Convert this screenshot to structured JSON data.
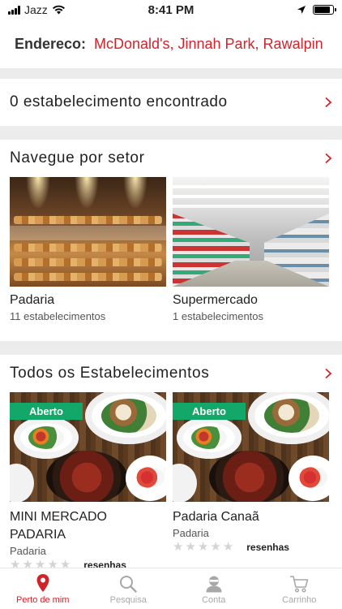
{
  "status_bar": {
    "carrier": "Jazz",
    "time": "8:41 PM"
  },
  "address": {
    "label": "Endereco:",
    "value": "McDonald's, Jinnah Park, Rawalpin"
  },
  "found": {
    "title": "0 estabelecimento encontrado"
  },
  "sectors_section": {
    "title": "Navegue por setor",
    "items": [
      {
        "name": "Padaria",
        "count": "11 estabelecimentos"
      },
      {
        "name": "Supermercado",
        "count": "1 estabelecimentos"
      }
    ]
  },
  "all_section": {
    "title": "Todos os Estabelecimentos",
    "stores": [
      {
        "badge": "Aberto",
        "name": "MINI MERCADO PADARIA",
        "category": "Padaria",
        "reviews": "resenhas",
        "rating": 0
      },
      {
        "badge": "Aberto",
        "name": "Padaria Canaã",
        "category": "Padaria",
        "reviews": "resenhas",
        "rating": 0
      }
    ]
  },
  "tabs": [
    {
      "label": "Perto de mim",
      "icon": "location-pin-icon",
      "active": true
    },
    {
      "label": "Pesquisa",
      "icon": "search-icon",
      "active": false
    },
    {
      "label": "Conta",
      "icon": "account-icon",
      "active": false
    },
    {
      "label": "Carrinho",
      "icon": "cart-icon",
      "active": false
    }
  ],
  "colors": {
    "accent": "#d0232a",
    "open_badge": "#13a86a",
    "inactive_tab": "#a8a8a8"
  }
}
